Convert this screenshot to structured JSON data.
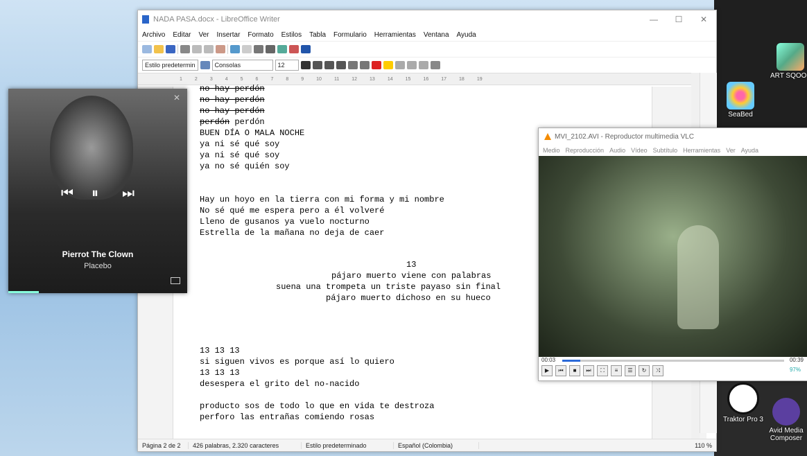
{
  "writer": {
    "title": "NADA PASA.docx - LibreOffice Writer",
    "menu": [
      "Archivo",
      "Editar",
      "Ver",
      "Insertar",
      "Formato",
      "Estilos",
      "Tabla",
      "Formulario",
      "Herramientas",
      "Ventana",
      "Ayuda"
    ],
    "style_combo": "Estilo predetermin",
    "font_combo": "Consolas",
    "size_combo": "12",
    "text_lines": [
      {
        "text": "no hay perdón",
        "strike": true
      },
      {
        "text": "no hay perdón",
        "strike": true
      },
      {
        "text": "no hay perdón",
        "strike": true
      },
      {
        "text": "perdón perdón",
        "strike_first": true
      },
      {
        "text": "BUEN DÍA O MALA NOCHE"
      },
      {
        "text": "ya ni sé qué soy"
      },
      {
        "text": "ya ni sé qué soy"
      },
      {
        "text": "ya no sé quién soy"
      },
      {
        "text": "Hay un hoyo en la tierra con mi forma y mi nombre"
      },
      {
        "text": "No sé qué me espera pero a él volveré"
      },
      {
        "text": "Lleno de gusanos ya vuelo nocturno"
      },
      {
        "text": "Estrella de la mañana no deja de caer"
      },
      {
        "text": "13"
      },
      {
        "text": "pájaro muerto viene con palabras"
      },
      {
        "text": "suena una trompeta un triste payaso sin final"
      },
      {
        "text": "pájaro muerto dichoso en su hueco"
      },
      {
        "text": "13 13 13"
      },
      {
        "text": "si siguen vivos es porque así lo quiero"
      },
      {
        "text": "13 13 13"
      },
      {
        "text": "desespera el grito del no-nacido"
      },
      {
        "text": "producto sos de todo lo que en vida te destroza"
      },
      {
        "text": "perforo las entrañas comiendo rosas"
      }
    ],
    "status": {
      "page": "Página 2 de 2",
      "words": "426 palabras, 2.320 caracteres",
      "style": "Estilo predeterminado",
      "language": "Español (Colombia)",
      "zoom": "110 %"
    }
  },
  "music": {
    "song": "Pierrot The Clown",
    "artist": "Placebo"
  },
  "vlc": {
    "title": "MVI_2102.AVI - Reproductor multimedia VLC",
    "menu": [
      "Medio",
      "Reproducción",
      "Audio",
      "Vídeo",
      "Subtítulo",
      "Herramientas",
      "Ver",
      "Ayuda"
    ],
    "time_current": "00:03",
    "time_total": "00:39",
    "volume": "97%"
  },
  "desktop": {
    "icons": [
      "ART SQOOL",
      "SeaBed",
      "Traktor Pro 3",
      "Avid Media Composer"
    ]
  }
}
